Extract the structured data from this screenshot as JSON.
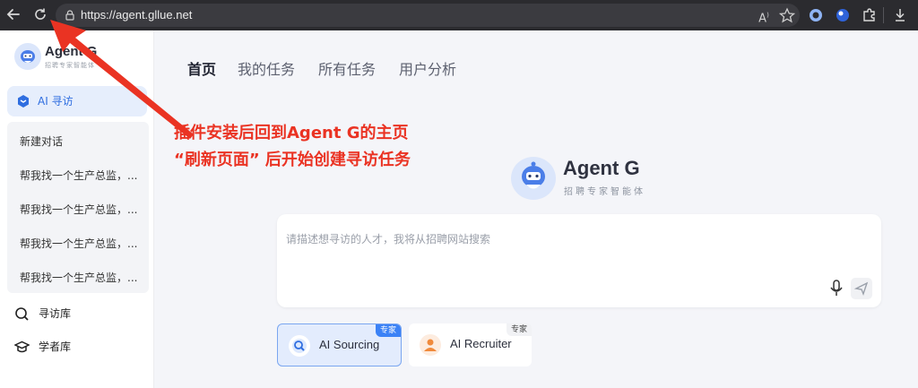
{
  "browser": {
    "url": "https://agent.gllue.net",
    "icons": [
      "back-arrow-icon",
      "reload-icon",
      "lock-icon",
      "read-aloud-icon",
      "star-icon",
      "extension-icons",
      "download-icon"
    ]
  },
  "sidebar": {
    "brand_title": "Agent G",
    "brand_subtitle": "招聘专家智能体",
    "active_nav": "AI 寻访",
    "new_chat": "新建对话",
    "chats": [
      "帮我找一个生产总监，...",
      "帮我找一个生产总监，...",
      "帮我找一个生产总监，...",
      "帮我找一个生产总监，..."
    ],
    "links": [
      {
        "label": "寻访库",
        "icon": "search-icon"
      },
      {
        "label": "学者库",
        "icon": "graduation-cap-icon"
      }
    ]
  },
  "main": {
    "tabs": [
      "首页",
      "我的任务",
      "所有任务",
      "用户分析"
    ],
    "hero_title": "Agent G",
    "hero_subtitle": "招聘专家智能体",
    "prompt_placeholder": "请描述想寻访的人才，我将从招聘网站搜索",
    "cards": [
      {
        "label": "AI Sourcing",
        "badge": "专家",
        "selected": true
      },
      {
        "label": "AI Recruiter",
        "badge": "专家",
        "selected": false
      }
    ]
  },
  "annotation": {
    "line1": "插件安装后回到Agent G的主页",
    "line2": "“刷新页面” 后开始创建寻访任务",
    "color": "#ea3323"
  },
  "colors": {
    "accent": "#2f6ee0",
    "chrome": "#2b2b2f"
  }
}
